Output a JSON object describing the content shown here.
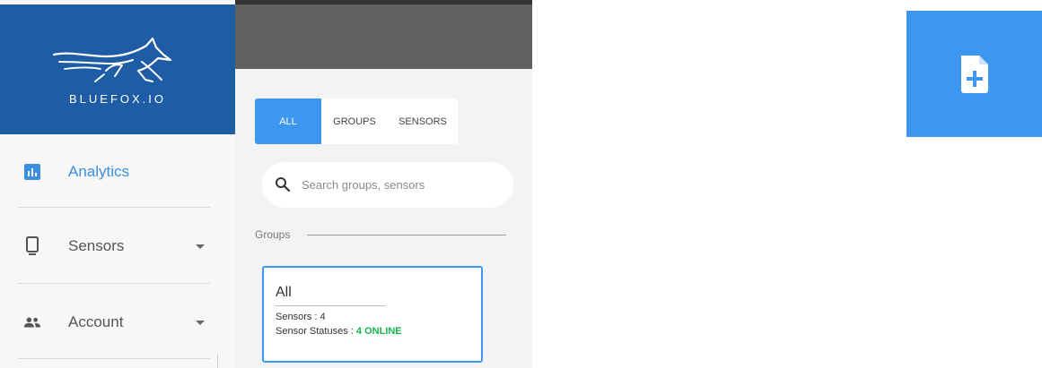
{
  "brand": {
    "name": "BLUEFOX.IO",
    "color": "#1f5ca6"
  },
  "sidebar": {
    "items": [
      {
        "label": "Analytics",
        "icon": "bar-chart-icon",
        "active": true,
        "has_caret": false
      },
      {
        "label": "Sensors",
        "icon": "phone-device-icon",
        "active": false,
        "has_caret": true
      },
      {
        "label": "Account",
        "icon": "people-icon",
        "active": false,
        "has_caret": true
      }
    ]
  },
  "filter": {
    "tabs": [
      {
        "label": "ALL",
        "active": true
      },
      {
        "label": "GROUPS",
        "active": false
      },
      {
        "label": "SENSORS",
        "active": false
      }
    ]
  },
  "search": {
    "placeholder": "Search groups, sensors",
    "value": ""
  },
  "groups": {
    "heading": "Groups",
    "cards": [
      {
        "title": "All",
        "sensors_label": "Sensors : ",
        "sensors_count": "4",
        "status_label": "Sensor Statuses : ",
        "status_value": "4 ONLINE"
      }
    ]
  },
  "actions": {
    "add_document_icon": "add-document-icon"
  },
  "colors": {
    "accent": "#3d97f0",
    "online": "#19b34f",
    "topbar": "#616161"
  }
}
